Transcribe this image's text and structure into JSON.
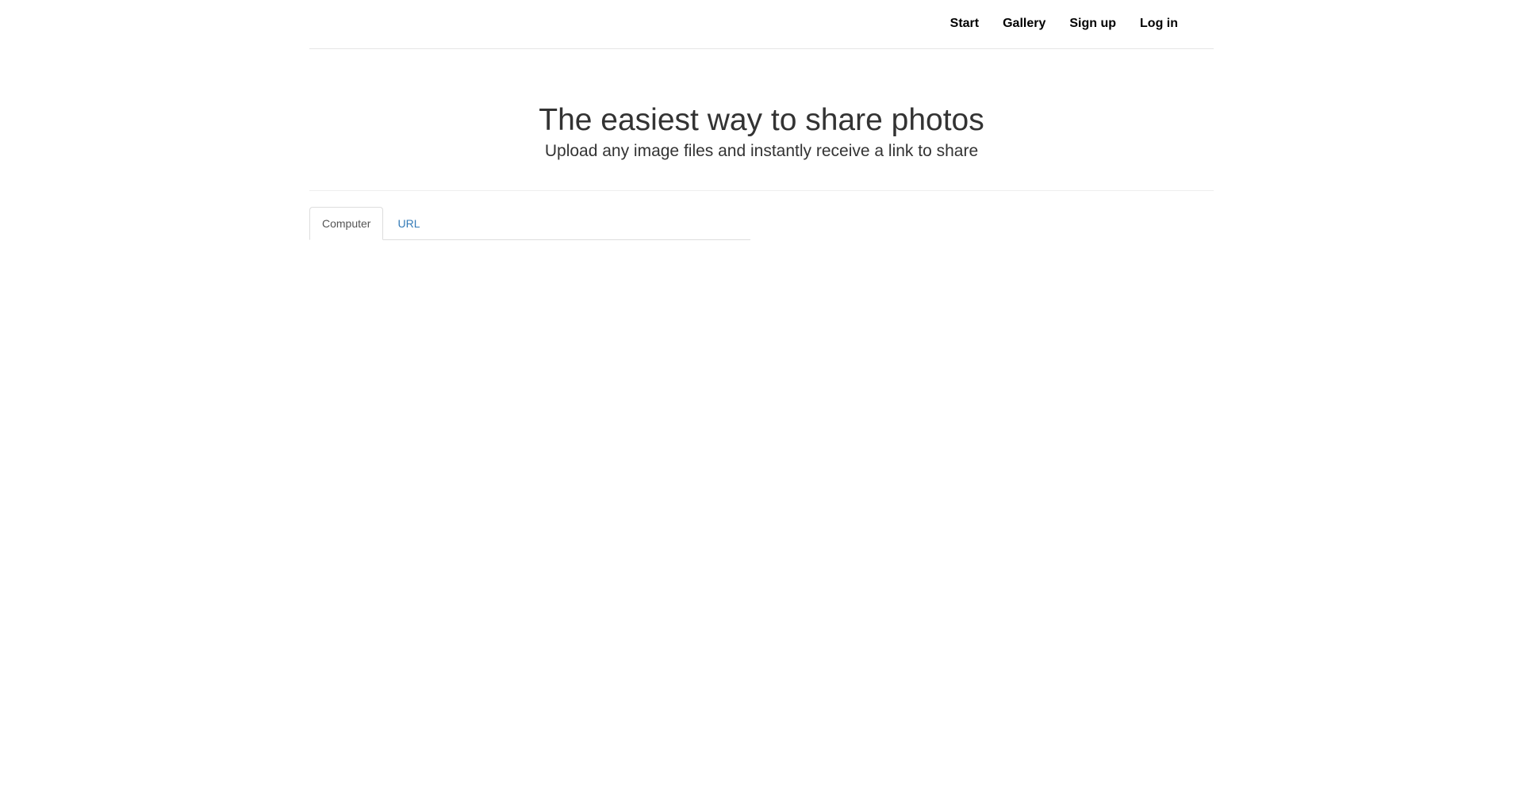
{
  "nav": {
    "items": [
      {
        "label": "Start"
      },
      {
        "label": "Gallery"
      },
      {
        "label": "Sign up"
      },
      {
        "label": "Log in"
      }
    ]
  },
  "hero": {
    "title": "The easiest way to share photos",
    "subtitle": "Upload any image files and instantly receive a link to share"
  },
  "tabs": [
    {
      "label": "Computer",
      "active": true
    },
    {
      "label": "URL",
      "active": false
    }
  ],
  "colors": {
    "link": "#337ab7",
    "text": "#333333",
    "active_tab_text": "#555555",
    "border": "#dddddd"
  }
}
